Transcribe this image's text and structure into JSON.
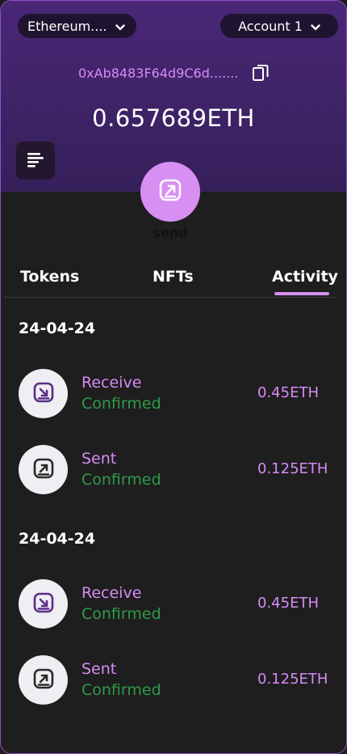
{
  "header": {
    "network": "Ethereum....",
    "account": "Account 1",
    "address": "0xAb8483F64d9C6d.......",
    "balance": "0.657689ETH"
  },
  "actions": {
    "send_label": "send"
  },
  "tabs": [
    {
      "label": "Tokens"
    },
    {
      "label": "NFTs"
    },
    {
      "label": "Activity"
    }
  ],
  "activity": [
    {
      "date": "24-04-24",
      "transactions": [
        {
          "type": "Receive",
          "status": "Confirmed",
          "amount": "0.45ETH",
          "icon": "receive-icon"
        },
        {
          "type": "Sent",
          "status": "Confirmed",
          "amount": "0.125ETH",
          "icon": "sent-icon"
        }
      ]
    },
    {
      "date": "24-04-24",
      "transactions": [
        {
          "type": "Receive",
          "status": "Confirmed",
          "amount": "0.45ETH",
          "icon": "receive-icon"
        },
        {
          "type": "Sent",
          "status": "Confirmed",
          "amount": "0.125ETH",
          "icon": "sent-icon"
        }
      ]
    }
  ],
  "colors": {
    "accent": "#d68bf5",
    "confirmed": "#2f9a4a",
    "header_top": "#4a2778",
    "background": "#1e1e1e"
  }
}
